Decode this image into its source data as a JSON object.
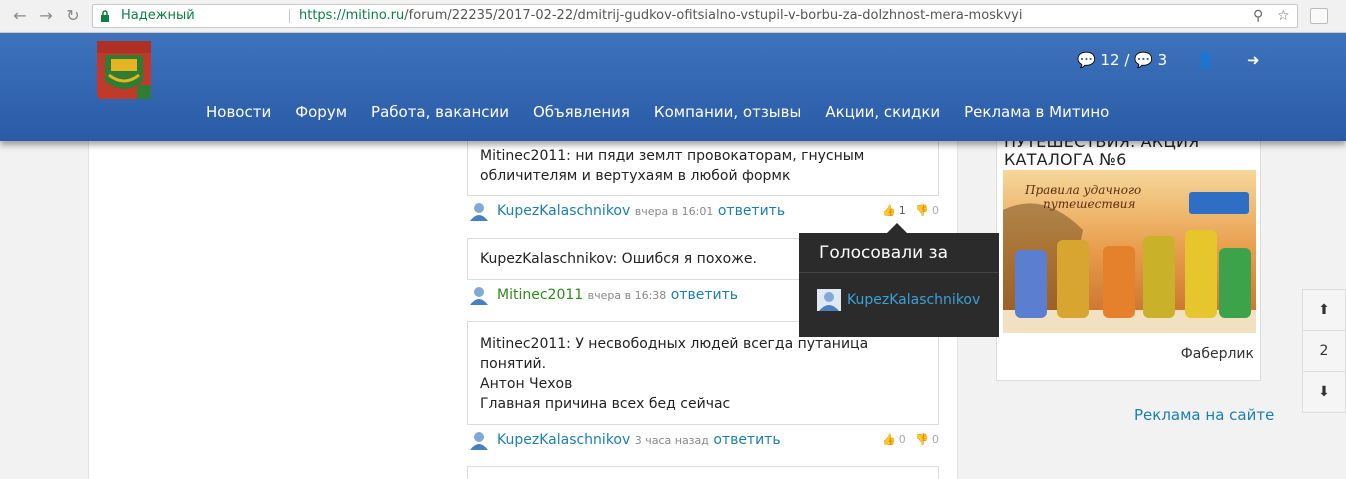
{
  "browser": {
    "secure_label": "Надежный",
    "url_host": "https://mitino.ru",
    "url_path": "/forum/22235/2017-02-22/dmitrij-gudkov-ofitsialno-vstupil-v-borbu-za-dolzhnost-mera-moskvyi"
  },
  "header": {
    "comments_count": "12",
    "separator": "/",
    "chats_count": "3",
    "nav": [
      "Новости",
      "Форум",
      "Работа, вакансии",
      "Объявления",
      "Компании, отзывы",
      "Акции, скидки",
      "Реклама в Митино"
    ]
  },
  "comments": [
    {
      "text_lines": [
        "Mitinec2011: ни пяди землт провокаторам, гнусным",
        "обличителям и вертухаям в любой формк"
      ],
      "author": "KupezKalaschnikov",
      "time": "вчера в 16:01",
      "reply": "ответить",
      "likes": "1",
      "dislikes": "0"
    },
    {
      "text_lines": [
        "KupezKalaschnikov: Ошибся я похоже."
      ],
      "author": "Mitinec2011",
      "time": "вчера в 16:38",
      "reply": "ответить"
    },
    {
      "text_lines": [
        "Mitinec2011: У несвободных людей всегда путаница",
        "понятий.",
        "Антон Чехов",
        "Главная причина всех бед сейчас"
      ],
      "author": "KupezKalaschnikov",
      "time": "3 часа назад",
      "reply": "ответить",
      "likes": "0",
      "dislikes": "0"
    }
  ],
  "tooltip": {
    "title": "Голосовали за",
    "user": "KupezKalaschnikov"
  },
  "sidebar": {
    "ad_title_1": "ПУТЕШЕСТВИЯ. АКЦИЯ",
    "ad_title_2": "КАТАЛОГА №6",
    "ad_banner_text_1": "Правила удачного",
    "ad_banner_text_2": "путешествия",
    "ad_caption": "Фаберлик",
    "ad_link": "Реклама на сайте"
  },
  "scroller": {
    "page": "2"
  },
  "colors": {
    "header_blue": "#2f62ad",
    "link_blue": "#1a7fb0",
    "author_green": "#2d8a1b",
    "secure_green": "#0b8043"
  }
}
